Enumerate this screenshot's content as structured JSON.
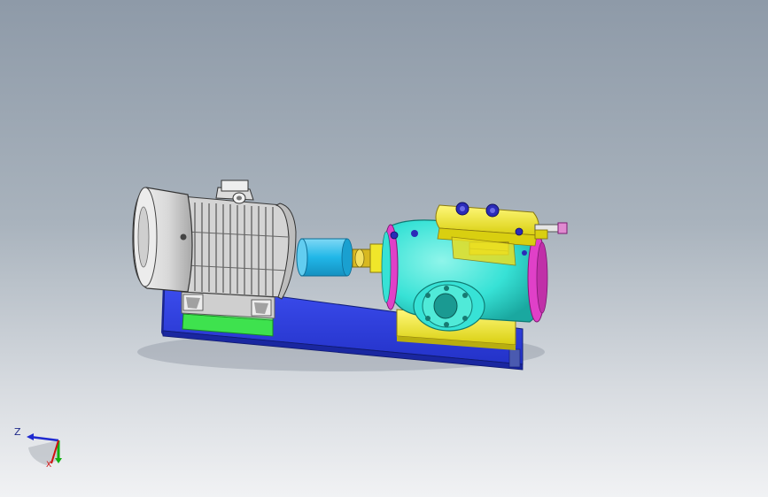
{
  "viewport": {
    "background_top": "#8e9aa8",
    "background_bottom": "#f1f2f4"
  },
  "model": {
    "colors": {
      "base": "#2f3fe0",
      "motor_body": "#e6e6e6",
      "motor_fins": "#bcbcbc",
      "coupling": "#21b7e8",
      "pump_body": "#37e2d6",
      "pump_flange": "#e040c8",
      "pump_top": "#f0e62a",
      "motor_feet": "#3ee24e",
      "bolts": "#2b2bb8"
    }
  },
  "triad": {
    "axis_z": "Z",
    "axis_x": "X",
    "z_color": "#1f2ad0",
    "y_color": "#10b010",
    "x_color": "#d01010"
  }
}
